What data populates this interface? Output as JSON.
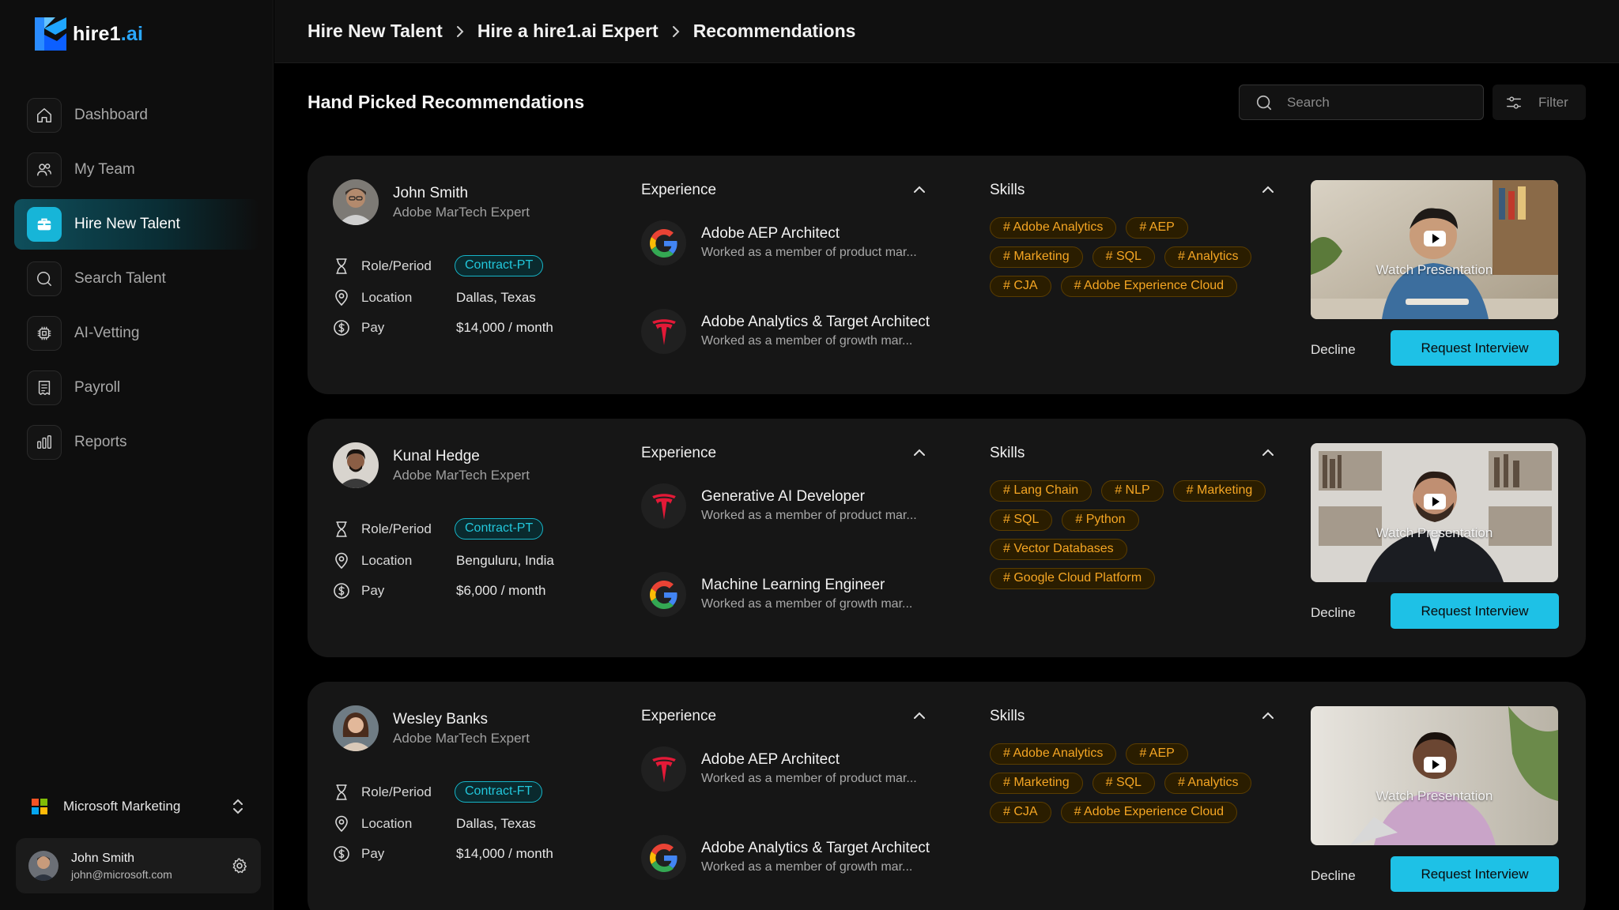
{
  "app": {
    "logo_text_1": "hire1",
    "logo_text_2": ".ai"
  },
  "sidebar": {
    "items": [
      {
        "label": "Dashboard",
        "icon": "home-icon",
        "active": false
      },
      {
        "label": "My Team",
        "icon": "users-icon",
        "active": false
      },
      {
        "label": "Hire New Talent",
        "icon": "briefcase-icon",
        "active": true
      },
      {
        "label": "Search Talent",
        "icon": "search-icon",
        "active": false
      },
      {
        "label": "AI-Vetting",
        "icon": "chip-icon",
        "active": false
      },
      {
        "label": "Payroll",
        "icon": "receipt-icon",
        "active": false
      },
      {
        "label": "Reports",
        "icon": "bar-chart-icon",
        "active": false
      }
    ],
    "org": {
      "name": "Microsoft Marketing"
    },
    "user": {
      "name": "John Smith",
      "email": "john@microsoft.com"
    }
  },
  "breadcrumb": [
    "Hire New Talent",
    "Hire a hire1.ai Expert",
    "Recommendations"
  ],
  "main": {
    "title": "Hand Picked Recommendations",
    "search_placeholder": "Search",
    "filter_label": "Filter",
    "labels": {
      "role": "Role/Period",
      "location": "Location",
      "pay": "Pay",
      "experience": "Experience",
      "skills": "Skills",
      "watch": "Watch Presentation",
      "decline": "Decline",
      "request": "Request Interview"
    }
  },
  "candidates": [
    {
      "name": "John Smith",
      "title": "Adobe MarTech Expert",
      "role": "Contract-PT",
      "location": "Dallas, Texas",
      "pay": "$14,000 / month",
      "experience": [
        {
          "company": "google",
          "title": "Adobe AEP Architect",
          "desc": "Worked as a member of product mar..."
        },
        {
          "company": "tesla",
          "title": "Adobe Analytics & Target Architect",
          "desc": "Worked as a member of growth mar..."
        }
      ],
      "skills": [
        "# Adobe Analytics",
        "# AEP",
        "# Marketing",
        "# SQL",
        "# Analytics",
        "# CJA",
        "# Adobe Experience Cloud"
      ]
    },
    {
      "name": "Kunal Hedge",
      "title": "Adobe MarTech Expert",
      "role": "Contract-PT",
      "location": "Benguluru, India",
      "pay": "$6,000 / month",
      "experience": [
        {
          "company": "tesla",
          "title": "Generative AI Developer",
          "desc": "Worked as a member of product mar..."
        },
        {
          "company": "google",
          "title": "Machine Learning Engineer",
          "desc": "Worked as a member of growth mar..."
        }
      ],
      "skills": [
        "# Lang Chain",
        "# NLP",
        "# Marketing",
        "# SQL",
        "# Python",
        "# Vector Databases",
        "# Google Cloud Platform"
      ]
    },
    {
      "name": "Wesley Banks",
      "title": "Adobe MarTech Expert",
      "role": "Contract-FT",
      "location": "Dallas, Texas",
      "pay": "$14,000 / month",
      "experience": [
        {
          "company": "tesla",
          "title": "Adobe AEP Architect",
          "desc": "Worked as a member of product mar..."
        },
        {
          "company": "google",
          "title": "Adobe Analytics & Target Architect",
          "desc": "Worked as a member of growth mar..."
        }
      ],
      "skills": [
        "# Adobe Analytics",
        "# AEP",
        "# Marketing",
        "# SQL",
        "# Analytics",
        "# CJA",
        "# Adobe Experience Cloud"
      ]
    }
  ],
  "colors": {
    "accent": "#1ec1e6",
    "skill": "#f5a623",
    "contract": "#22c7db"
  }
}
